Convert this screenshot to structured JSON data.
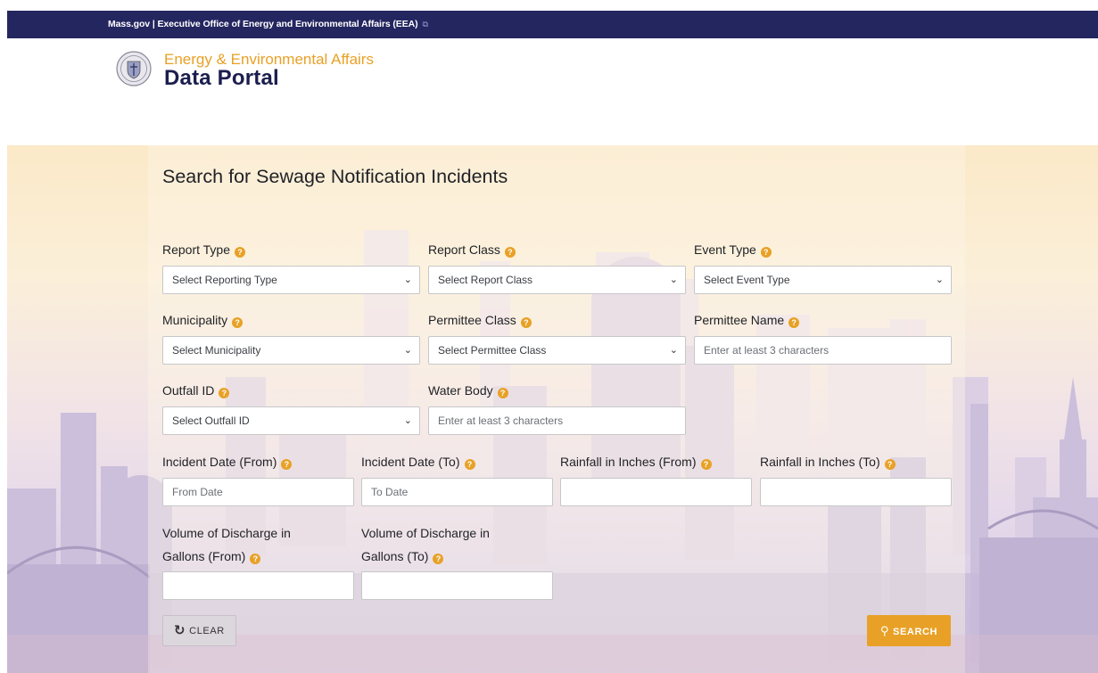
{
  "topbar": {
    "text": "Mass.gov | Executive Office of Energy and Environmental Affairs (EEA)",
    "ext_icon": "external-link-icon"
  },
  "brand": {
    "line1": "Energy & Environmental Affairs",
    "line2": "Data Portal",
    "seal_icon": "state-seal-icon"
  },
  "form": {
    "title": "Search for Sewage Notification Incidents",
    "help_glyph": "?",
    "report_type": {
      "label": "Report Type",
      "value": "Select Reporting Type"
    },
    "report_class": {
      "label": "Report Class",
      "value": "Select Report Class"
    },
    "event_type": {
      "label": "Event Type",
      "value": "Select Event Type"
    },
    "municipality": {
      "label": "Municipality",
      "value": "Select Municipality"
    },
    "permittee_class": {
      "label": "Permittee Class",
      "value": "Select Permittee Class"
    },
    "permittee_name": {
      "label": "Permittee Name",
      "placeholder": "Enter at least 3 characters"
    },
    "outfall_id": {
      "label": "Outfall ID",
      "value": "Select Outfall ID"
    },
    "water_body": {
      "label": "Water Body",
      "placeholder": "Enter at least 3 characters"
    },
    "incident_from": {
      "label": "Incident Date (From)",
      "placeholder": "From Date"
    },
    "incident_to": {
      "label": "Incident Date (To)",
      "placeholder": "To Date"
    },
    "rain_from": {
      "label": "Rainfall in Inches (From)",
      "placeholder": ""
    },
    "rain_to": {
      "label": "Rainfall in Inches (To)",
      "placeholder": ""
    },
    "vol_from": {
      "label_line1": "Volume of Discharge in",
      "label_line2": "Gallons (From)",
      "placeholder": ""
    },
    "vol_to": {
      "label_line1": "Volume of Discharge in",
      "label_line2": "Gallons (To)",
      "placeholder": ""
    },
    "chevron": "⌄",
    "clear": {
      "label": "CLEAR",
      "icon": "refresh-icon"
    },
    "search": {
      "label": "SEARCH",
      "icon": "search-icon"
    }
  },
  "colors": {
    "navy": "#242660",
    "gold": "#e8a126",
    "dark_title": "#1b1e4d"
  }
}
